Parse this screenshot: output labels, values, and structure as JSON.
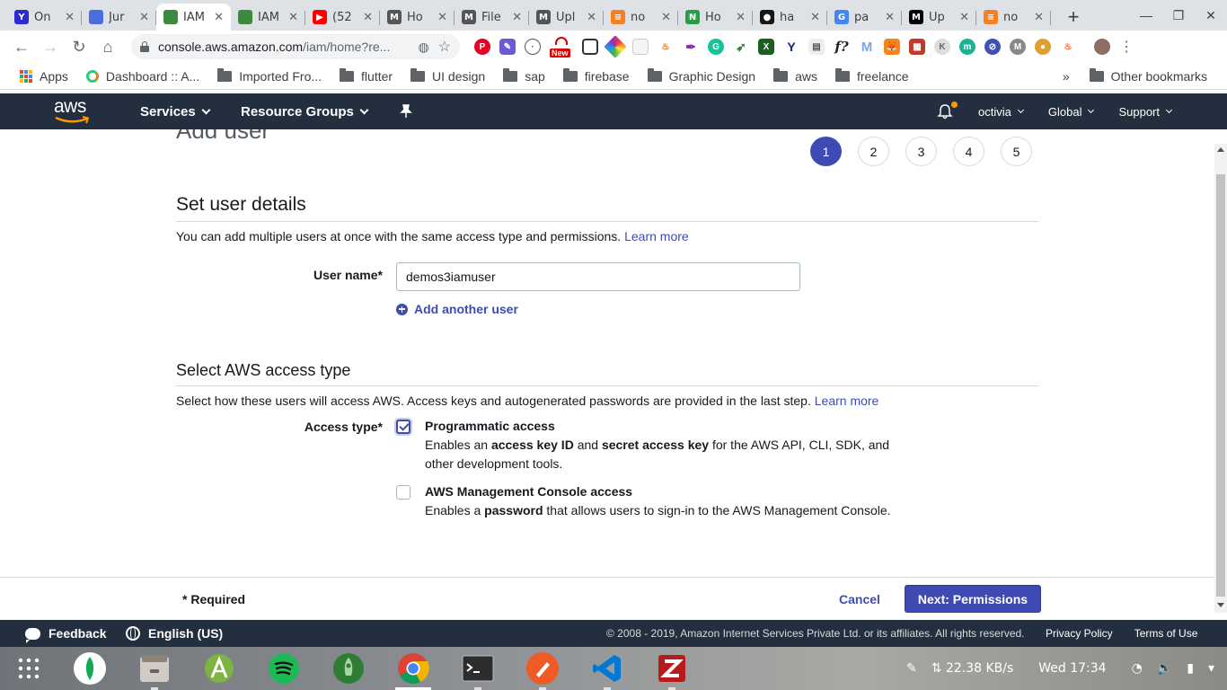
{
  "browser": {
    "tabs": [
      {
        "title": "On",
        "fav_color": "#2b2bd0",
        "fav_glyph": "Y",
        "icon": "yahoo-icon"
      },
      {
        "title": "Jur",
        "fav_color": "#4a6ee0",
        "fav_glyph": "",
        "icon": "chat-bubble-icon"
      },
      {
        "title": "IAM",
        "fav_color": "#3d8a3f",
        "fav_glyph": "",
        "icon": "aws-iam-icon"
      },
      {
        "title": "IAM",
        "fav_color": "#3d8a3f",
        "fav_glyph": "",
        "icon": "aws-iam-icon"
      },
      {
        "title": "(52",
        "fav_color": "#ff0000",
        "fav_glyph": "▶",
        "icon": "youtube-icon"
      },
      {
        "title": "Ho",
        "fav_color": "#555",
        "fav_glyph": "M",
        "icon": "medium-icon"
      },
      {
        "title": "File",
        "fav_color": "#555",
        "fav_glyph": "M",
        "icon": "medium-icon"
      },
      {
        "title": "Upl",
        "fav_color": "#555",
        "fav_glyph": "M",
        "icon": "medium-icon"
      },
      {
        "title": "no",
        "fav_color": "#f48024",
        "fav_glyph": "≡",
        "icon": "stackoverflow-icon"
      },
      {
        "title": "Ho",
        "fav_color": "#2c9a4b",
        "fav_glyph": "N",
        "icon": "n-icon"
      },
      {
        "title": "ha",
        "fav_color": "#181717",
        "fav_glyph": "●",
        "icon": "github-icon"
      },
      {
        "title": "pa",
        "fav_color": "#4285f4",
        "fav_glyph": "G",
        "icon": "google-icon"
      },
      {
        "title": "Up",
        "fav_color": "#000",
        "fav_glyph": "M",
        "icon": "medium-icon"
      },
      {
        "title": "no",
        "fav_color": "#f48024",
        "fav_glyph": "≡",
        "icon": "stackoverflow-icon"
      }
    ],
    "active_tab_index": 2,
    "url_host": "console.aws.amazon.com",
    "url_path": "/iam/home?re...",
    "bookmarks": [
      {
        "label": "Apps",
        "type": "apps"
      },
      {
        "label": "Dashboard :: A...",
        "type": "site"
      },
      {
        "label": "Imported Fro...",
        "type": "folder"
      },
      {
        "label": "flutter",
        "type": "folder"
      },
      {
        "label": "UI design",
        "type": "folder"
      },
      {
        "label": "sap",
        "type": "folder"
      },
      {
        "label": "firebase",
        "type": "folder"
      },
      {
        "label": "Graphic Design",
        "type": "folder"
      },
      {
        "label": "aws",
        "type": "folder"
      },
      {
        "label": "freelance",
        "type": "folder"
      }
    ],
    "bookmarks_overflow": "»",
    "other_bookmarks": "Other bookmarks",
    "extension_new_badge": "New"
  },
  "aws_nav": {
    "logo": "aws",
    "services": "Services",
    "resource_groups": "Resource Groups",
    "user": "octivia",
    "region": "Global",
    "support": "Support"
  },
  "wizard": {
    "title": "Add user",
    "steps": [
      "1",
      "2",
      "3",
      "4",
      "5"
    ],
    "current_step": 1
  },
  "user_details": {
    "heading": "Set user details",
    "description": "You can add multiple users at once with the same access type and permissions.",
    "learn_more": "Learn more",
    "user_name_label": "User name*",
    "user_name_value": "demos3iamuser",
    "add_another": "Add another user"
  },
  "access_type": {
    "heading": "Select AWS access type",
    "description": "Select how these users will access AWS. Access keys and autogenerated passwords are provided in the last step.",
    "learn_more": "Learn more",
    "label": "Access type*",
    "programmatic": {
      "title": "Programmatic access",
      "desc_1": "Enables an ",
      "desc_b1": "access key ID",
      "desc_2": " and ",
      "desc_b2": "secret access key",
      "desc_3": " for the AWS API, CLI, SDK, and other development tools.",
      "checked": true
    },
    "console": {
      "title": "AWS Management Console access",
      "desc_1": "Enables a ",
      "desc_b1": "password",
      "desc_2": " that allows users to sign-in to the AWS Management Console.",
      "checked": false
    }
  },
  "actions": {
    "required": "* Required",
    "cancel": "Cancel",
    "next": "Next: Permissions"
  },
  "footer": {
    "feedback": "Feedback",
    "language": "English (US)",
    "copyright": "© 2008 - 2019, Amazon Internet Services Private Ltd. or its affiliates. All rights reserved.",
    "privacy": "Privacy Policy",
    "terms": "Terms of Use"
  },
  "taskbar": {
    "apps": [
      "mongodb-icon",
      "files-icon",
      "android-studio-icon",
      "spotify-icon",
      "rocket-icon",
      "chrome-icon",
      "terminal-icon",
      "postman-icon",
      "vscode-icon",
      "filezilla-icon"
    ],
    "network_speed": "22.38 KB/s",
    "clock": "Wed 17:34"
  },
  "colors": {
    "aws_nav_bg": "#232f3e",
    "primary": "#3f4bb3",
    "aws_orange": "#ff9900"
  }
}
